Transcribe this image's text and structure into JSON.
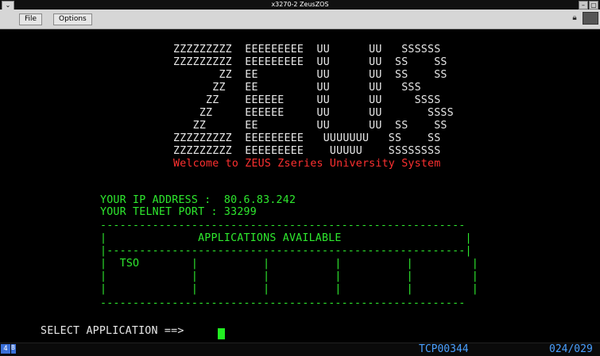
{
  "window": {
    "title": "x3270-2 ZeusZOS",
    "menu_button_glyph": "⌄",
    "window_buttons": [
      "–",
      "▢"
    ]
  },
  "menubar": {
    "file_label": "File",
    "options_label": "Options"
  },
  "screen": {
    "banner": [
      "ZZZZZZZZZ  EEEEEEEEE  UU      UU   SSSSSS",
      "ZZZZZZZZZ  EEEEEEEEE  UU      UU  SS    SS",
      "       ZZ  EE         UU      UU  SS    SS",
      "      ZZ   EE         UU      UU   SSS",
      "     ZZ    EEEEEE     UU      UU     SSSS",
      "    ZZ     EEEEEE     UU      UU       SSSS",
      "   ZZ      EE         UU      UU  SS    SS",
      "ZZZZZZZZZ  EEEEEEEEE   UUUUUUU   SS    SS",
      "ZZZZZZZZZ  EEEEEEEEE    UUUUU    SSSSSSSS"
    ],
    "welcome": "Welcome to ZEUS Zseries University System",
    "ip_line": "YOUR IP ADDRESS :  80.6.83.242",
    "port_line": "YOUR TELNET PORT : 33299",
    "table_lines": [
      "--------------------------------------------------------",
      "|              APPLICATIONS AVAILABLE                   |",
      "|-------------------------------------------------------|",
      "|  TSO        |          |          |          |         |",
      "|             |          |          |          |         |",
      "|             |          |          |          |         |",
      "--------------------------------------------------------"
    ],
    "select_prompt": "SELECT APPLICATION ==>"
  },
  "status": {
    "indicator": "4",
    "indicator2": "B",
    "lu_name": "TCP00344",
    "cursor_position": "024/029"
  },
  "colors": {
    "background": "#000000",
    "banner_text": "#e8e8e8",
    "info_text": "#2ee82e",
    "welcome_text": "#ff3030",
    "status_text": "#4aa0ff"
  }
}
